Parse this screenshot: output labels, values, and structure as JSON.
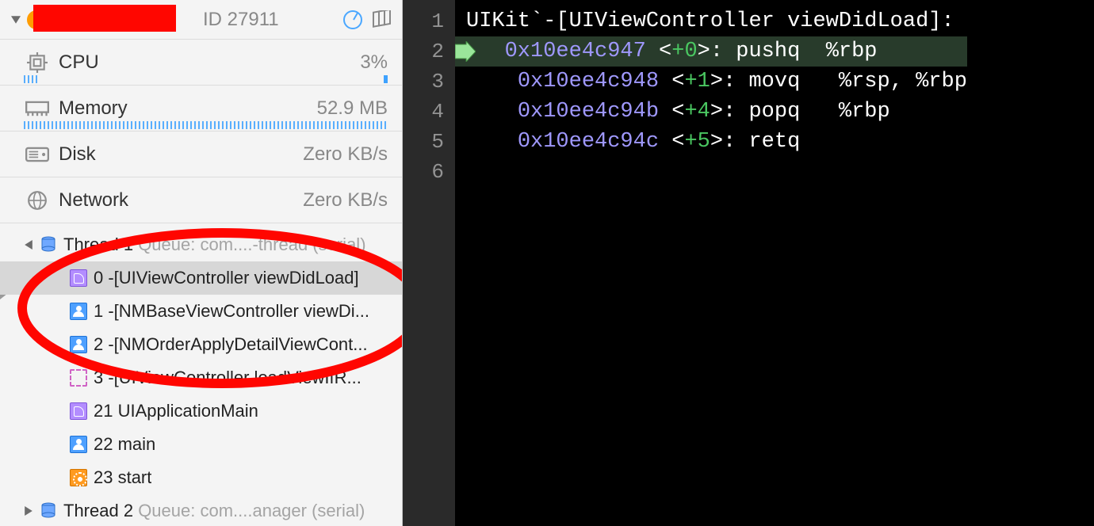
{
  "process": {
    "pid_text": "ID 27911",
    "tools": {
      "gauge": "gauge-icon",
      "layers": "view-stack-icon"
    }
  },
  "metrics": {
    "cpu": {
      "label": "CPU",
      "value": "3%"
    },
    "memory": {
      "label": "Memory",
      "value": "52.9 MB"
    },
    "disk": {
      "label": "Disk",
      "value": "Zero KB/s"
    },
    "network": {
      "label": "Network",
      "value": "Zero KB/s"
    }
  },
  "thread1": {
    "name": "Thread 1",
    "queue": "Queue: com....-thread (serial)",
    "frames": [
      {
        "idx": "0",
        "label": "-[UIViewController viewDidLoad]",
        "icon": "fr-app",
        "selected": true
      },
      {
        "idx": "1",
        "label": "-[NMBaseViewController viewDi...",
        "icon": "fr-user",
        "selected": false
      },
      {
        "idx": "2",
        "label": "-[NMOrderApplyDetailViewCont...",
        "icon": "fr-user",
        "selected": false
      },
      {
        "idx": "3",
        "label": "-[UIViewController loadViewIfR...",
        "icon": "fr-dash",
        "selected": false
      },
      {
        "idx": "21",
        "label": "UIApplicationMain",
        "icon": "fr-app",
        "selected": false
      },
      {
        "idx": "22",
        "label": "main",
        "icon": "fr-user",
        "selected": false
      },
      {
        "idx": "23",
        "label": "start",
        "icon": "fr-sys",
        "selected": false
      }
    ]
  },
  "thread2": {
    "name": "Thread 2",
    "queue": "Queue: com....anager (serial)"
  },
  "editor": {
    "title": "UIKit`-[UIViewController viewDidLoad]:",
    "pc_prefix": "->",
    "lines": [
      {
        "n": 1,
        "addr": "",
        "offset": "",
        "inst": "",
        "args": ""
      },
      {
        "n": 2,
        "addr": "0x10ee4c947",
        "offset": "+0",
        "inst": "pushq",
        "args": "%rbp"
      },
      {
        "n": 3,
        "addr": "0x10ee4c948",
        "offset": "+1",
        "inst": "movq",
        "args": "%rsp, %rbp"
      },
      {
        "n": 4,
        "addr": "0x10ee4c94b",
        "offset": "+4",
        "inst": "popq",
        "args": "%rbp"
      },
      {
        "n": 5,
        "addr": "0x10ee4c94c",
        "offset": "+5",
        "inst": "retq",
        "args": ""
      },
      {
        "n": 6,
        "addr": "",
        "offset": "",
        "inst": "",
        "args": ""
      }
    ]
  },
  "annotation": {
    "red_oval_color": "#ff0600",
    "redaction_color": "#ff0600"
  }
}
